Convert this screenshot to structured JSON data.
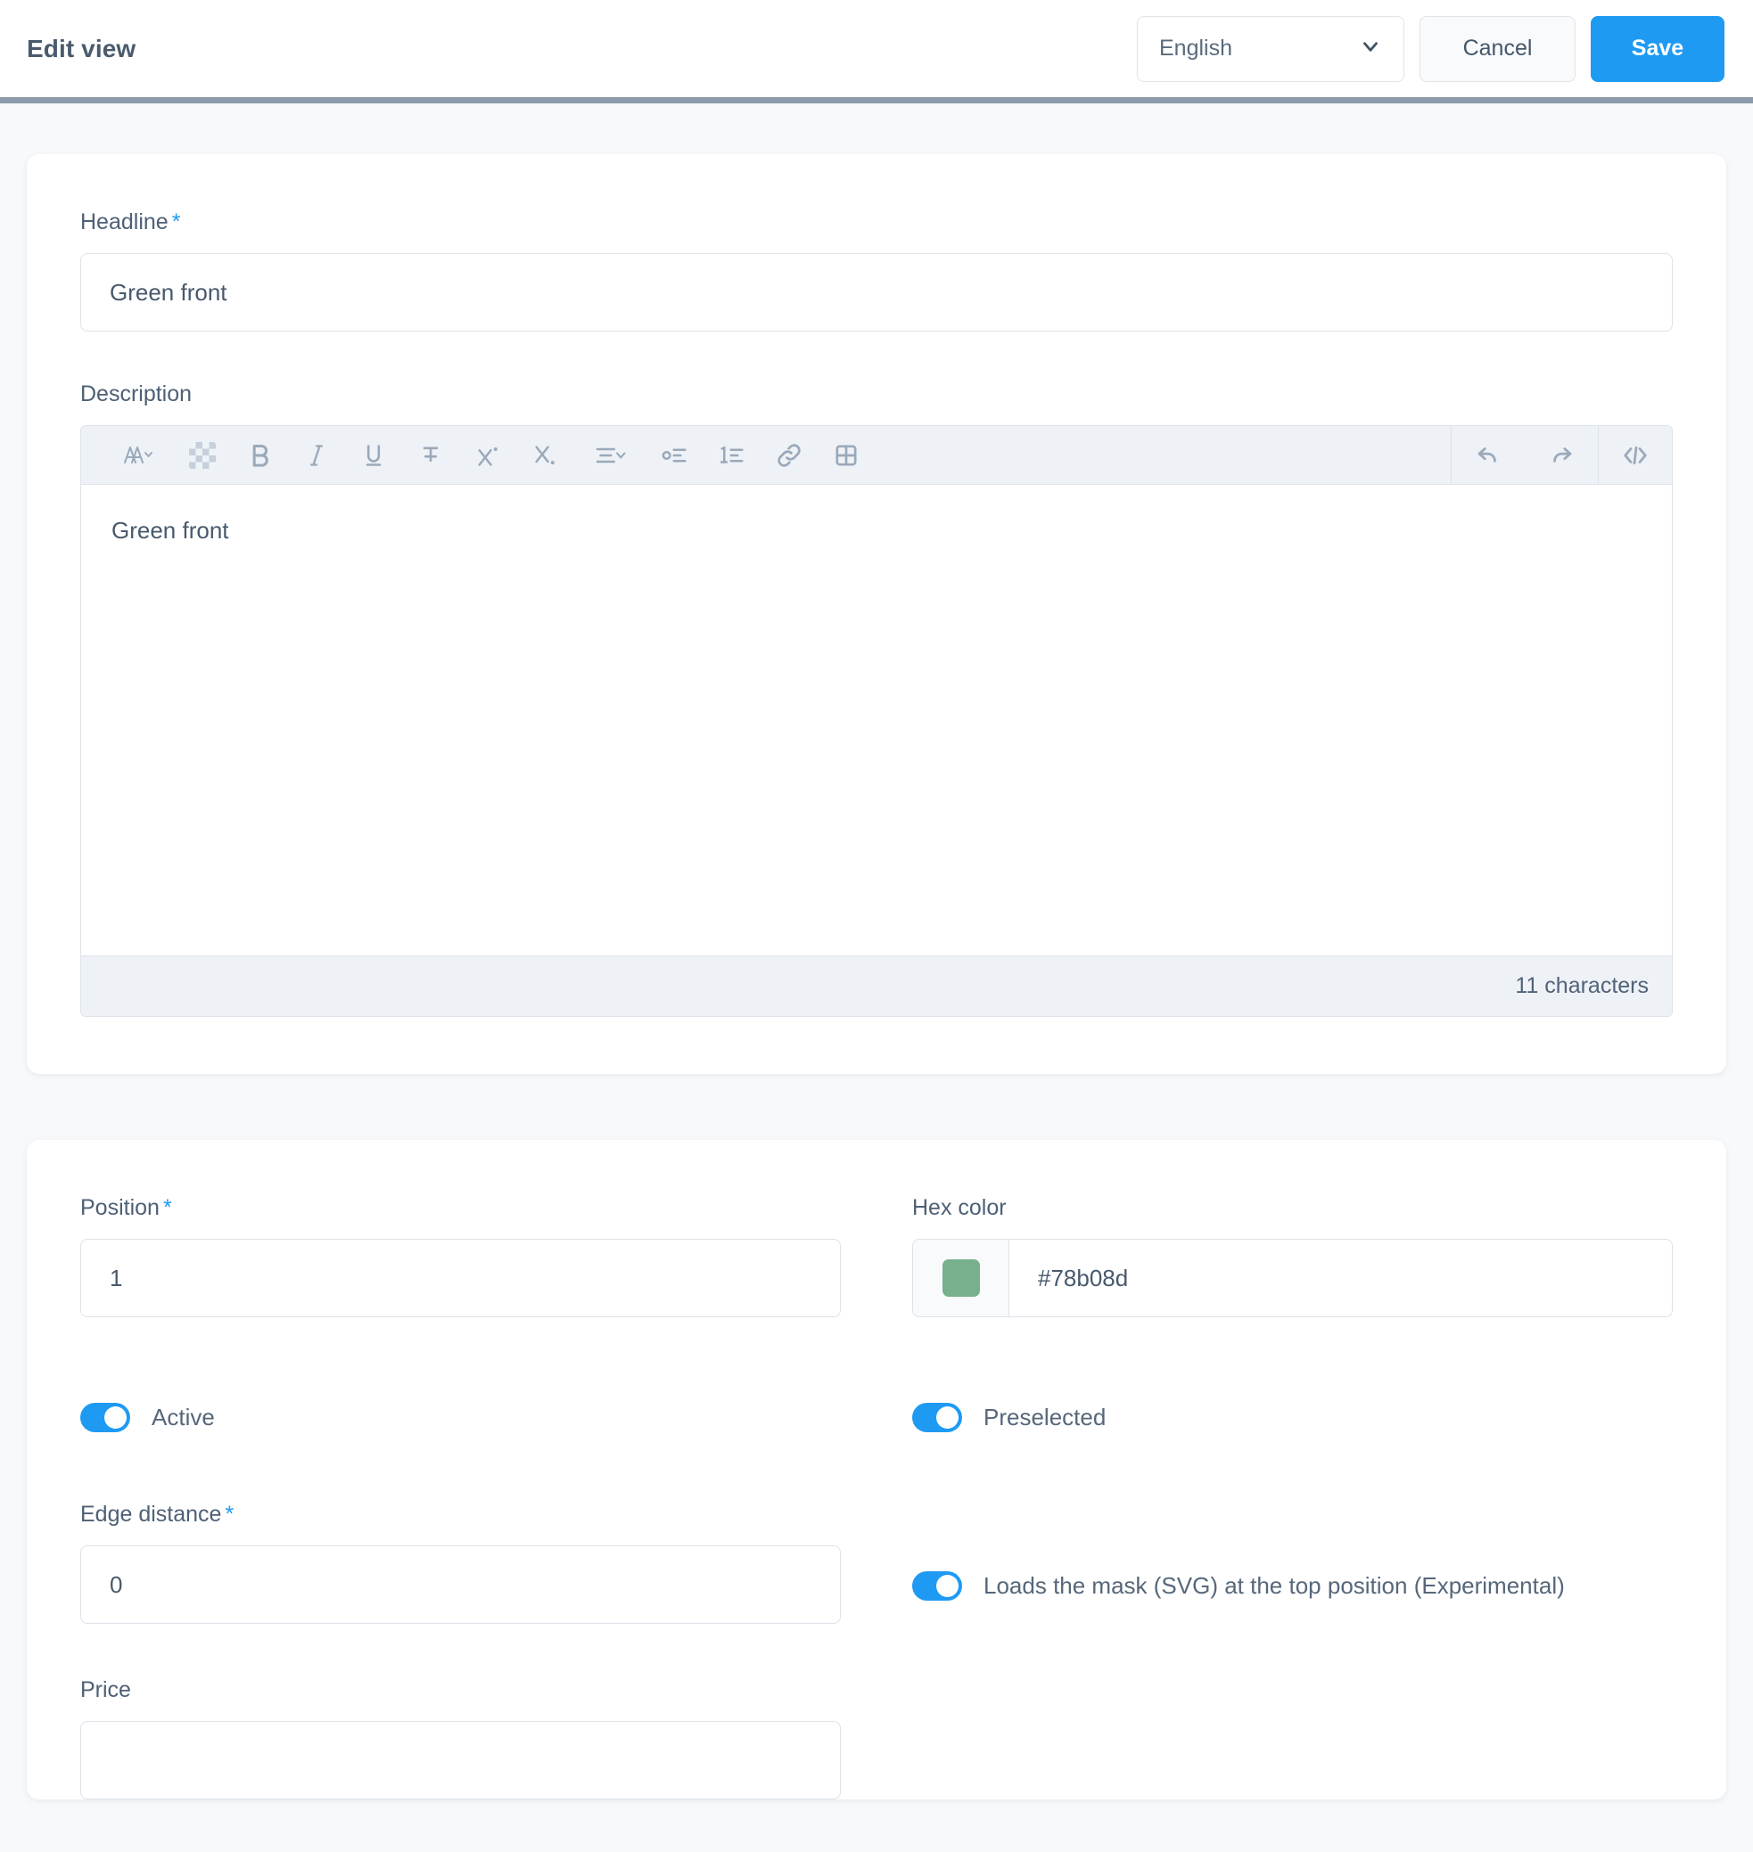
{
  "header": {
    "title": "Edit view",
    "language_value": "English",
    "cancel_label": "Cancel",
    "save_label": "Save"
  },
  "accent_color": "#1e9af3",
  "form": {
    "headline": {
      "label": "Headline",
      "required_marker": "*",
      "value": "Green front"
    },
    "description": {
      "label": "Description",
      "content": "Green front",
      "character_count": "11 characters",
      "toolbar": {
        "left": [
          {
            "icon": "font-style-icon",
            "label": "Font style"
          },
          {
            "icon": "chevron-down-icon",
            "label": "Font style options"
          },
          {
            "icon": "background-color-icon",
            "label": "Background color"
          },
          {
            "icon": "bold-icon",
            "label": "Bold"
          },
          {
            "icon": "italic-icon",
            "label": "Italic"
          },
          {
            "icon": "underline-icon",
            "label": "Underline"
          },
          {
            "icon": "strikethrough-icon",
            "label": "Strikethrough"
          },
          {
            "icon": "superscript-icon",
            "label": "Superscript"
          },
          {
            "icon": "subscript-icon",
            "label": "Subscript"
          },
          {
            "icon": "align-icon",
            "label": "Text alignment"
          },
          {
            "icon": "chevron-down-icon",
            "label": "Alignment options"
          },
          {
            "icon": "bullet-list-icon",
            "label": "Bulleted list"
          },
          {
            "icon": "numbered-list-icon",
            "label": "Numbered list"
          },
          {
            "icon": "link-icon",
            "label": "Insert link"
          },
          {
            "icon": "table-icon",
            "label": "Insert table"
          }
        ],
        "right": [
          {
            "icon": "undo-icon",
            "label": "Undo"
          },
          {
            "icon": "redo-icon",
            "label": "Redo"
          },
          {
            "icon": "code-view-icon",
            "label": "Source code"
          }
        ]
      }
    },
    "position": {
      "label": "Position",
      "required_marker": "*",
      "value": "1"
    },
    "hex_color": {
      "label": "Hex color",
      "value": "#78b08d",
      "swatch_color": "#78b08d"
    },
    "active": {
      "label": "Active",
      "state": "on"
    },
    "preselected": {
      "label": "Preselected",
      "state": "on"
    },
    "edge_distance": {
      "label": "Edge distance",
      "required_marker": "*",
      "value": "0"
    },
    "svg_mask": {
      "label": "Loads the mask (SVG) at the top position (Experimental)",
      "state": "on"
    },
    "price": {
      "label": "Price"
    }
  }
}
